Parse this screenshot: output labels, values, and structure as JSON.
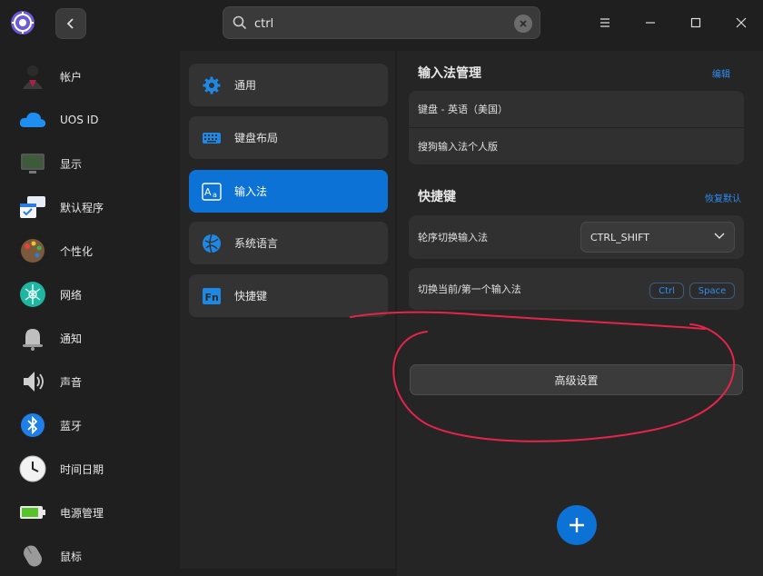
{
  "search": {
    "value": "ctrl"
  },
  "sidebar": {
    "items": [
      {
        "label": "帐户",
        "icon": "account-icon"
      },
      {
        "label": "UOS ID",
        "icon": "cloud-icon"
      },
      {
        "label": "显示",
        "icon": "display-icon"
      },
      {
        "label": "默认程序",
        "icon": "default-apps-icon"
      },
      {
        "label": "个性化",
        "icon": "palette-icon"
      },
      {
        "label": "网络",
        "icon": "network-icon"
      },
      {
        "label": "通知",
        "icon": "bell-icon"
      },
      {
        "label": "声音",
        "icon": "speaker-icon"
      },
      {
        "label": "蓝牙",
        "icon": "bluetooth-icon"
      },
      {
        "label": "时间日期",
        "icon": "clock-icon"
      },
      {
        "label": "电源管理",
        "icon": "battery-icon"
      },
      {
        "label": "鼠标",
        "icon": "mouse-icon"
      }
    ]
  },
  "nav": {
    "items": [
      {
        "label": "通用",
        "icon": "gear-icon"
      },
      {
        "label": "键盘布局",
        "icon": "keyboard-icon"
      },
      {
        "label": "输入法",
        "icon": "input-method-icon",
        "active": true
      },
      {
        "label": "系统语言",
        "icon": "language-icon"
      },
      {
        "label": "快捷键",
        "icon": "fn-key-icon"
      }
    ]
  },
  "input_methods": {
    "title": "输入法管理",
    "edit_label": "编辑",
    "items": [
      "键盘 - 英语（美国）",
      "搜狗输入法个人版"
    ]
  },
  "shortcuts": {
    "title": "快捷键",
    "reset_label": "恢复默认",
    "switch_order_label": "轮序切换输入法",
    "switch_order_value": "CTRL_SHIFT",
    "toggle_label": "切换当前/第一个输入法",
    "keys": [
      "Ctrl",
      "Space"
    ]
  },
  "advanced_label": "高级设置",
  "colors": {
    "accent": "#0d72d6",
    "link": "#2f8df5",
    "annotation": "#e5244a"
  }
}
